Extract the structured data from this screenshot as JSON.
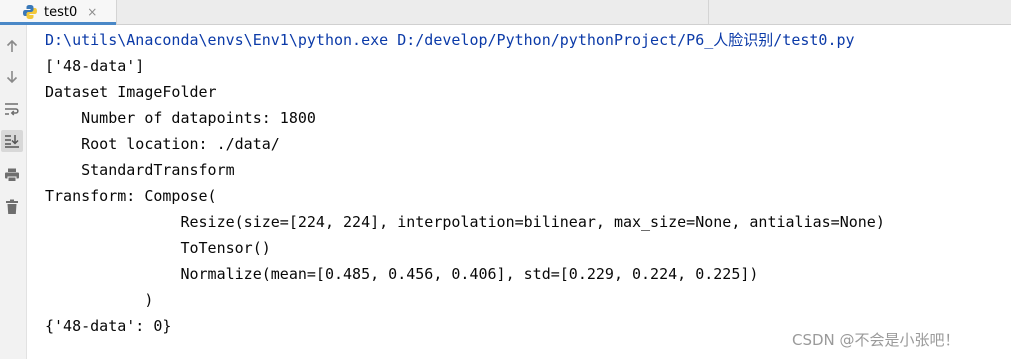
{
  "tab": {
    "label": "test0",
    "close": "×",
    "icon": "python-icon"
  },
  "toolbar": {
    "items": [
      {
        "name": "up-arrow-icon"
      },
      {
        "name": "down-arrow-icon"
      },
      {
        "name": "soft-wrap-icon"
      },
      {
        "name": "scroll-to-end-icon",
        "active": true
      },
      {
        "name": "print-icon"
      },
      {
        "name": "trash-icon"
      }
    ]
  },
  "console": {
    "lines": [
      "D:\\utils\\Anaconda\\envs\\Env1\\python.exe D:/develop/Python/pythonProject/P6_人脸识别/test0.py",
      "['48-data']",
      "Dataset ImageFolder",
      "    Number of datapoints: 1800",
      "    Root location: ./data/",
      "    StandardTransform",
      "Transform: Compose(",
      "               Resize(size=[224, 224], interpolation=bilinear, max_size=None, antialias=None)",
      "               ToTensor()",
      "               Normalize(mean=[0.485, 0.456, 0.406], std=[0.229, 0.224, 0.225])",
      "           )",
      "{'48-data': 0}"
    ]
  },
  "watermark": "CSDN @不会是小张吧！",
  "colors": {
    "command": "#0b3aa8",
    "output": "#080808",
    "tab_underline": "#4a88c7"
  }
}
